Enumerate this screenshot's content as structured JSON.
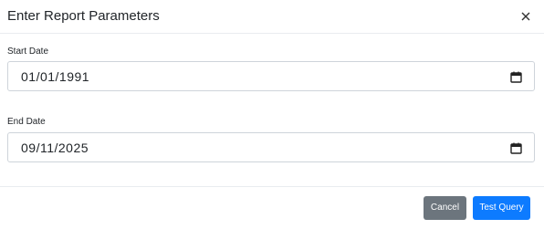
{
  "dialog": {
    "title": "Enter Report Parameters"
  },
  "fields": {
    "start_date": {
      "label": "Start Date",
      "value": "01/01/1991"
    },
    "end_date": {
      "label": "End Date",
      "value": "09/11/2025"
    }
  },
  "footer": {
    "cancel_label": "Cancel",
    "submit_label": "Test Query"
  },
  "icons": {
    "close": "close-icon",
    "calendar": "calendar-icon"
  },
  "colors": {
    "cancel_button": "#6c757d",
    "primary_button": "#0d7bff",
    "border": "#ced4da"
  }
}
